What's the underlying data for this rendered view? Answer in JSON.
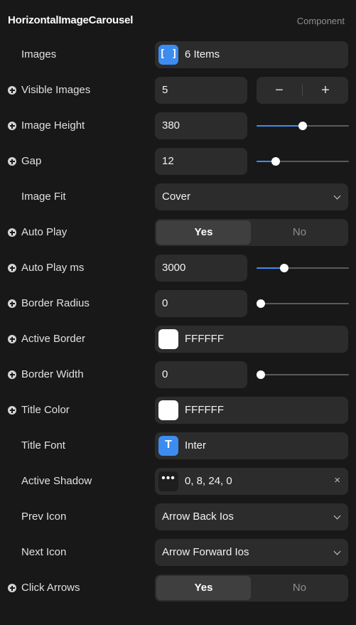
{
  "header": {
    "title": "HorizontalImageCarousel",
    "type_label": "Component"
  },
  "props": {
    "images": {
      "label": "Images",
      "value": "6 Items",
      "icon": "array-icon",
      "icon_glyph": "[ ]"
    },
    "visible_images": {
      "label": "Visible Images",
      "value": "5",
      "minus": "−",
      "plus": "+"
    },
    "image_height": {
      "label": "Image Height",
      "value": "380",
      "slider_fraction": 0.5
    },
    "gap": {
      "label": "Gap",
      "value": "12",
      "slider_fraction": 0.18
    },
    "image_fit": {
      "label": "Image Fit",
      "value": "Cover"
    },
    "auto_play": {
      "label": "Auto Play",
      "yes": "Yes",
      "no": "No",
      "selected": "Yes"
    },
    "auto_play_ms": {
      "label": "Auto Play ms",
      "value": "3000",
      "slider_fraction": 0.28
    },
    "border_radius": {
      "label": "Border Radius",
      "value": "0",
      "slider_fraction": 0
    },
    "active_border": {
      "label": "Active Border",
      "value": "FFFFFF",
      "color": "#FFFFFF"
    },
    "border_width": {
      "label": "Border Width",
      "value": "0",
      "slider_fraction": 0
    },
    "title_color": {
      "label": "Title Color",
      "value": "FFFFFF",
      "color": "#FFFFFF"
    },
    "title_font": {
      "label": "Title Font",
      "value": "Inter",
      "icon": "font-icon",
      "icon_glyph": "T"
    },
    "active_shadow": {
      "label": "Active Shadow",
      "value": "0, 8, 24, 0",
      "icon": "more-icon",
      "icon_glyph": "•••",
      "clear": "×"
    },
    "prev_icon": {
      "label": "Prev Icon",
      "value": "Arrow Back Ios"
    },
    "next_icon": {
      "label": "Next Icon",
      "value": "Arrow Forward Ios"
    },
    "click_arrows": {
      "label": "Click Arrows",
      "yes": "Yes",
      "no": "No",
      "selected": "Yes"
    }
  },
  "colors": {
    "accent": "#3D8CF0",
    "background": "#181818",
    "field": "#2C2C2C"
  }
}
